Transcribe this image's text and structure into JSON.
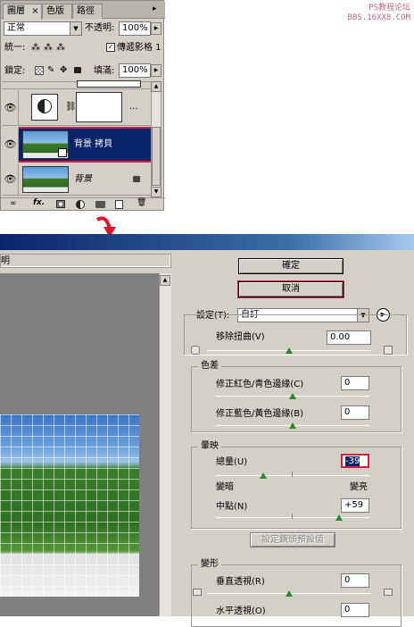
{
  "watermark": {
    "line1": "PS教程论坛",
    "line2": "BBS.16XX8.COM"
  },
  "layers_panel": {
    "tabs": [
      "圖層",
      "色版",
      "路徑"
    ],
    "close_glyph": "×",
    "blend_mode": "正常",
    "opacity_label": "不透明:",
    "opacity_value": "100%",
    "unify_label": "統一:",
    "propagate_label": "傳遞影格 1",
    "lock_label": "鎖定:",
    "fill_label": "填滿:",
    "fill_value": "100%",
    "layers": [
      {
        "name": "...",
        "kind": "adjustment"
      },
      {
        "name": "背景 拷貝",
        "kind": "image",
        "selected": true
      },
      {
        "name": "背景",
        "kind": "image",
        "locked": true
      }
    ]
  },
  "dialog": {
    "left_label": "明",
    "ok_label": "確定",
    "cancel_label": "取消",
    "settings_label": "設定(T):",
    "settings_value": "自訂",
    "remove_distortion_label": "移除扭曲(V)",
    "remove_distortion_value": "0.00",
    "chromatic_group": "色差",
    "fix_red_cyan_label": "修正紅色/青色邊緣(C)",
    "fix_red_cyan_value": "0",
    "fix_blue_yellow_label": "修正藍色/黃色邊緣(B)",
    "fix_blue_yellow_value": "0",
    "vignette_group": "暈映",
    "amount_label": "總量(U)",
    "amount_value": "-39",
    "darken_label": "變暗",
    "lighten_label": "變亮",
    "midpoint_label": "中點(N)",
    "midpoint_value": "+59",
    "default_lens_button": "設定鏡頭預設值",
    "transform_group": "變形",
    "vertical_persp_label": "垂直透視(R)",
    "vertical_persp_value": "0",
    "horizontal_persp_label": "水平透視(O)",
    "horizontal_persp_value": "0",
    "slider_levels": {
      "remove_distortion": 0.5,
      "fix_red_cyan": 0.5,
      "fix_blue_yellow": 0.5,
      "amount": 0.31,
      "midpoint": 0.8,
      "vertical": 0.5
    }
  },
  "colors": {
    "selection": "#0a246a",
    "highlight_border": "#d02040",
    "slider_knob": "#2a8a2a"
  }
}
